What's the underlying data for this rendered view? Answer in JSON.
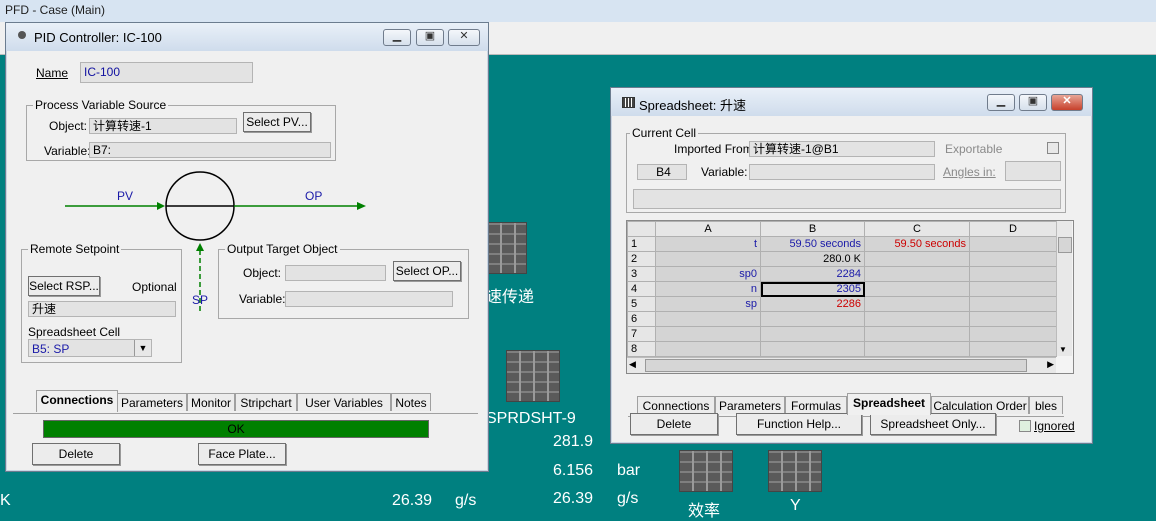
{
  "main": {
    "title": "PFD - Case (Main)"
  },
  "pfd": {
    "labels": {
      "sudu": "速传递",
      "sprdsht": "SPRDSHT-9",
      "v1": "281.9",
      "v2": "6.156",
      "u2": "bar",
      "v3": "26.39",
      "u3": "g/s",
      "v4": "26.39",
      "u4": "g/s",
      "k": "K",
      "xiaolv": "效率",
      "y": "Y"
    }
  },
  "pid": {
    "title": "PID Controller: IC-100",
    "name_label": "Name",
    "name_value": "IC-100",
    "pv_group": "Process Variable Source",
    "pv_object_label": "Object:",
    "pv_object_value": "计算转速-1",
    "pv_variable_label": "Variable:",
    "pv_variable_value": "B7:",
    "select_pv": "Select PV...",
    "pv_arrow": "PV",
    "op_arrow": "OP",
    "sp_arrow": "SP",
    "rsp_group": "Remote Setpoint",
    "select_rsp": "Select RSP...",
    "optional": "Optional",
    "rsp_value": "升速",
    "ss_cell_label": "Spreadsheet Cell",
    "ss_cell_value": "B5: SP",
    "op_group": "Output Target Object",
    "op_object_label": "Object:",
    "op_object_value": "",
    "op_variable_label": "Variable:",
    "op_variable_value": "",
    "select_op": "Select OP...",
    "tabs": [
      "Connections",
      "Parameters",
      "Monitor",
      "Stripchart",
      "User Variables",
      "Notes"
    ],
    "status": "OK",
    "delete": "Delete",
    "face_plate": "Face Plate..."
  },
  "ss": {
    "title": "Spreadsheet: 升速",
    "current_cell": "Current Cell",
    "imported_label": "Imported From:",
    "imported_value": "计算转速-1@B1",
    "exportable": "Exportable",
    "cell_ref": "B4",
    "variable_label": "Variable:",
    "variable_value": "",
    "angles": "Angles in:",
    "col_headers": [
      "A",
      "B",
      "C",
      "D"
    ],
    "rows": [
      {
        "n": "1",
        "a": "t",
        "b": "59.50 seconds",
        "c": "59.50 seconds"
      },
      {
        "n": "2",
        "a": "",
        "b": "280.0 K",
        "c": ""
      },
      {
        "n": "3",
        "a": "sp0",
        "b": "2284",
        "c": ""
      },
      {
        "n": "4",
        "a": "n",
        "b": "2305",
        "c": ""
      },
      {
        "n": "5",
        "a": "sp",
        "b": "2286",
        "c": ""
      },
      {
        "n": "6",
        "a": "",
        "b": "",
        "c": ""
      },
      {
        "n": "7",
        "a": "",
        "b": "",
        "c": ""
      },
      {
        "n": "8",
        "a": "",
        "b": "",
        "c": ""
      }
    ],
    "tabs": [
      "Connections",
      "Parameters",
      "Formulas",
      "Spreadsheet",
      "Calculation Order",
      "bles"
    ],
    "delete": "Delete",
    "function_help": "Function Help...",
    "ss_only": "Spreadsheet Only...",
    "ignored": "Ignored"
  },
  "colors": {
    "pfd_bg": "#008080",
    "status_green": "#008000",
    "arrow_green": "#008000",
    "label_blue": "#1a1aa8",
    "value_red": "#cc0000"
  }
}
